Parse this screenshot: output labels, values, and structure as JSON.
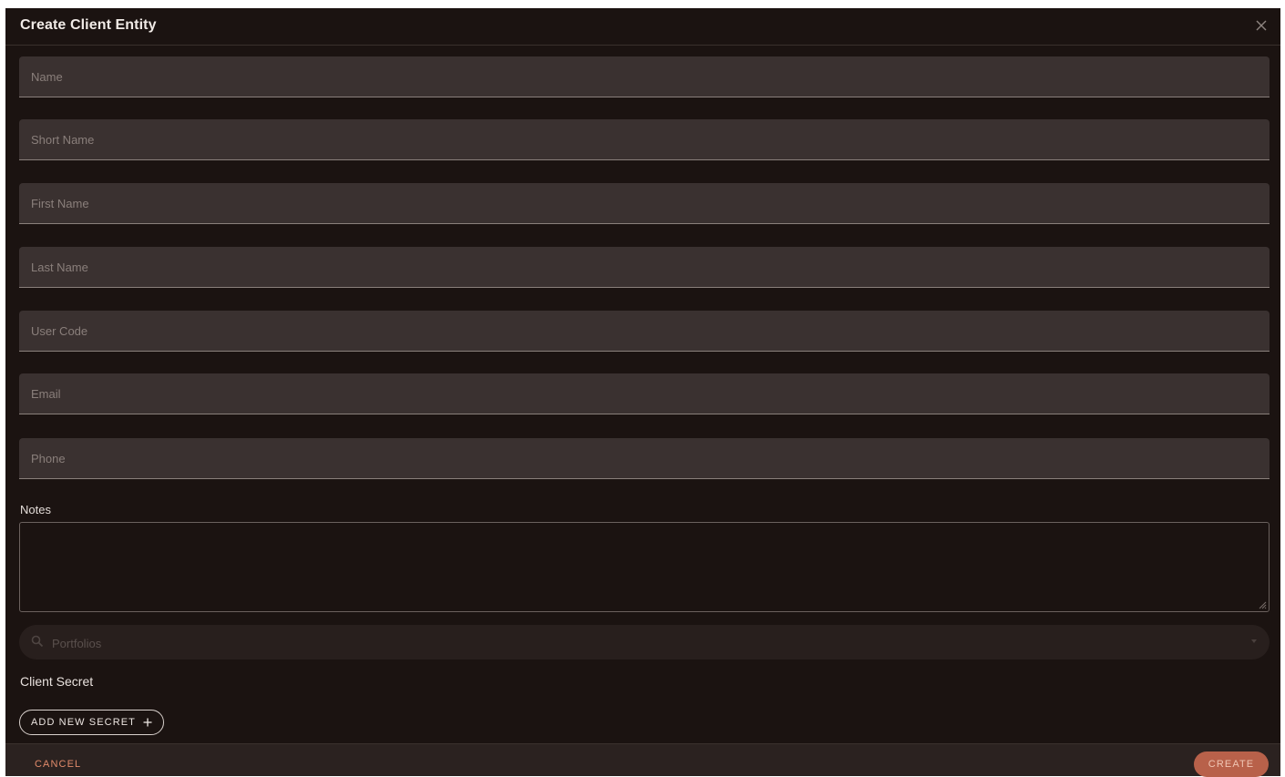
{
  "dialog": {
    "title": "Create Client Entity",
    "close_icon": "close-icon"
  },
  "fields": {
    "name": {
      "placeholder": "Name",
      "value": ""
    },
    "short_name": {
      "placeholder": "Short Name",
      "value": ""
    },
    "first_name": {
      "placeholder": "First Name",
      "value": ""
    },
    "last_name": {
      "placeholder": "Last Name",
      "value": ""
    },
    "user_code": {
      "placeholder": "User Code",
      "value": ""
    },
    "email": {
      "placeholder": "Email",
      "value": ""
    },
    "phone": {
      "placeholder": "Phone",
      "value": ""
    }
  },
  "notes": {
    "label": "Notes",
    "value": ""
  },
  "portfolios": {
    "placeholder": "Portfolios",
    "icon": "search-icon"
  },
  "client_secret": {
    "label": "Client Secret",
    "add_button_label": "ADD NEW SECRET",
    "add_icon": "plus-icon"
  },
  "footer": {
    "cancel_label": "CANCEL",
    "create_label": "CREATE"
  },
  "colors": {
    "background": "#1b1311",
    "field_background": "#3a3130",
    "accent": "#b8614a",
    "cancel_text": "#e08a6a"
  }
}
